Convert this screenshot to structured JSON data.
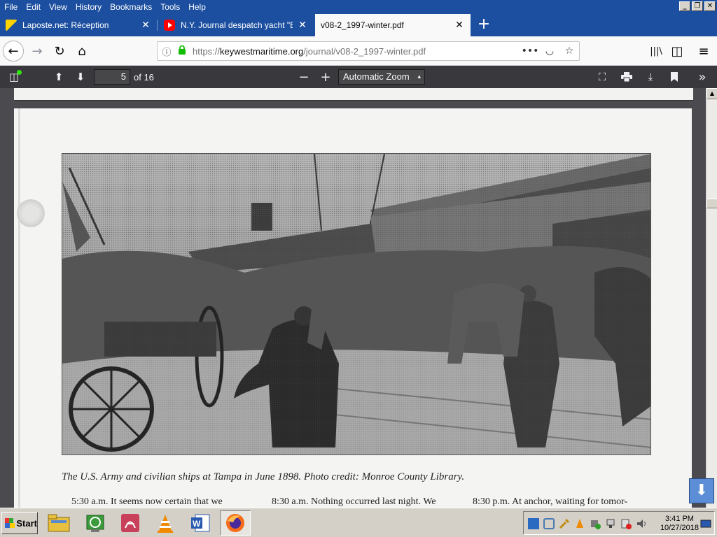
{
  "menubar": {
    "items": [
      "File",
      "Edit",
      "View",
      "History",
      "Bookmarks",
      "Tools",
      "Help"
    ]
  },
  "window_controls": {
    "minimize": "_",
    "maximize": "❐",
    "close": "✕"
  },
  "tabs": [
    {
      "title": "Laposte.net: Réception",
      "close": "✕"
    },
    {
      "title": "N.Y. Journal despatch yacht \"Bucc",
      "close": "✕"
    },
    {
      "title": "v08-2_1997-winter.pdf",
      "close": "✕",
      "active": true
    }
  ],
  "newtab": "+",
  "nav": {
    "back": "←",
    "forward": "→",
    "reload": "↻",
    "home": "⌂",
    "url_scheme": "https://",
    "url_host": "keywestmaritime.org",
    "url_path": "/journal/v08-2_1997-winter.pdf",
    "info_icon": "ⓘ",
    "page_actions": "•••",
    "pocket": "◡",
    "bookmark_star": "☆",
    "library": "|||\\",
    "sidebar": "◫",
    "menu": "≡"
  },
  "pdf_toolbar": {
    "sidebar_toggle": "◫",
    "prev_page": "⬆",
    "next_page": "⬇",
    "page_number": "5",
    "page_of": "of 16",
    "zoom_out": "−",
    "zoom_in": "+",
    "zoom_value": "Automatic Zoom",
    "zoom_arrow": "▲▼",
    "presentation": "⛶",
    "print": "🖶",
    "download": "⤓",
    "bookmark": "🔖",
    "tools": "»"
  },
  "document": {
    "caption": "The U.S. Army and civilian ships at Tampa in June 1898. Photo credit: Monroe County Library.",
    "columns": [
      "5:30 a.m. It seems now certain that we",
      "8:30 a.m. Nothing occurred last night. We",
      "8:30 p.m. At anchor, waiting for tomor-"
    ]
  },
  "scrollbar": {
    "up": "▲",
    "download_arrow": "⬇"
  },
  "taskbar": {
    "start_label": "Start",
    "apps": [
      "file-manager",
      "sync-tool",
      "acrobat",
      "vlc",
      "word",
      "firefox"
    ],
    "clock_time": "3:41 PM",
    "clock_date": "10/27/2018"
  },
  "colors": {
    "titlebar": "#1c4fa0",
    "pdf_toolbar": "#38383d",
    "viewer_bg": "#4a4a4f",
    "secure_lock": "#12bc00"
  }
}
